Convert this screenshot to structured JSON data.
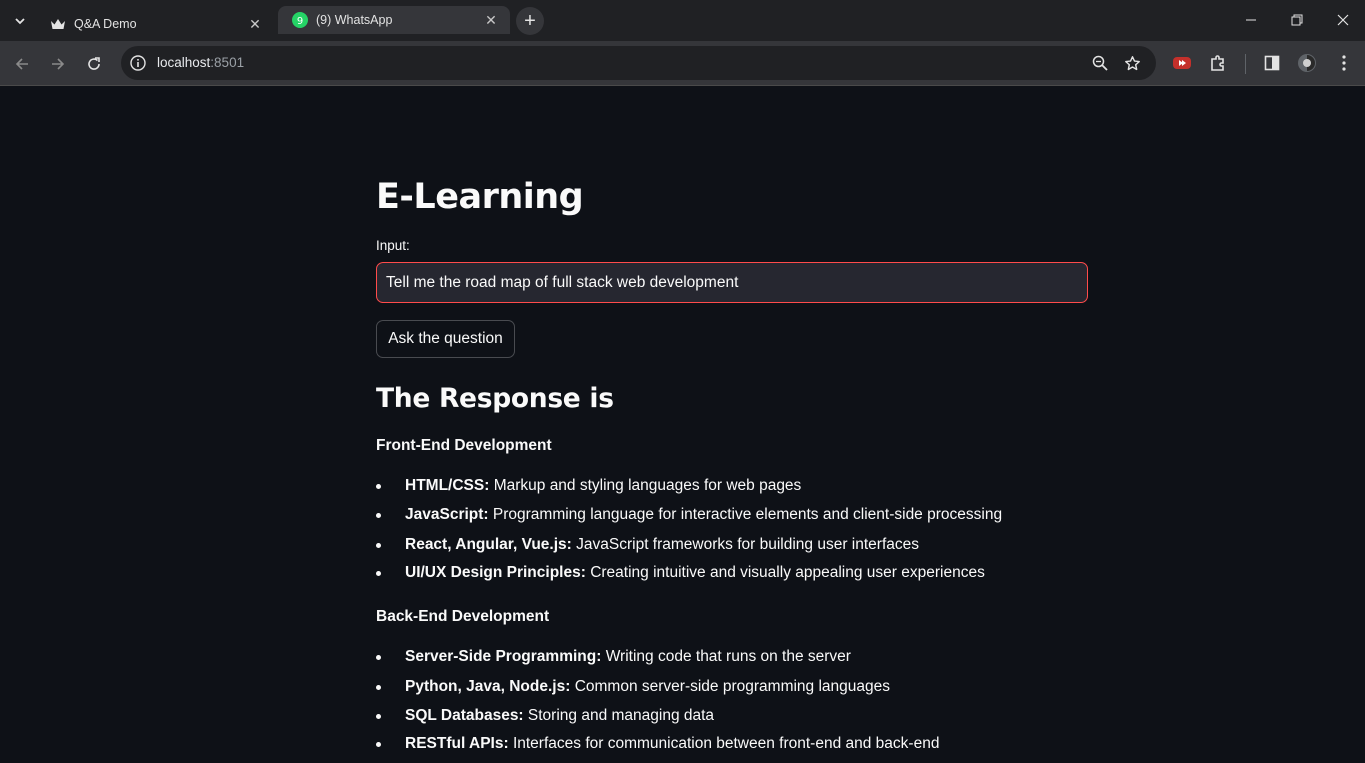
{
  "browser": {
    "tabs": [
      {
        "title": "Q&A Demo",
        "icon": "crown-icon",
        "active": false
      },
      {
        "title": "(9) WhatsApp",
        "icon": "whatsapp-icon",
        "badge": "9",
        "active": true
      }
    ],
    "address": {
      "host": "localhost",
      "port": ":8501"
    },
    "colors": {
      "tabbar": "#202124",
      "toolbar": "#35363a",
      "omnibox": "#202124"
    }
  },
  "app": {
    "title": "E-Learning",
    "input": {
      "label": "Input:",
      "value": "Tell me the road map of full stack web development"
    },
    "button_label": "Ask the question",
    "response_heading": "The Response is",
    "sections": [
      {
        "title": "Front-End Development",
        "items": [
          {
            "term": "HTML/CSS:",
            "desc": " Markup and styling languages for web pages"
          },
          {
            "term": "JavaScript:",
            "desc": " Programming language for interactive elements and client-side processing"
          },
          {
            "term": "React, Angular, Vue.js:",
            "desc": " JavaScript frameworks for building user interfaces"
          },
          {
            "term": "UI/UX Design Principles:",
            "desc": " Creating intuitive and visually appealing user experiences"
          }
        ]
      },
      {
        "title": "Back-End Development",
        "items": [
          {
            "term": "Server-Side Programming:",
            "desc": " Writing code that runs on the server"
          },
          {
            "term": "Python, Java, Node.js:",
            "desc": " Common server-side programming languages"
          },
          {
            "term": "SQL Databases:",
            "desc": " Storing and managing data"
          },
          {
            "term": "RESTful APIs:",
            "desc": " Interfaces for communication between front-end and back-end"
          }
        ]
      }
    ],
    "colors": {
      "background": "#0e1117",
      "text": "#fafafa",
      "input_bg": "#262730",
      "focus_border": "#ff4b4b"
    }
  }
}
